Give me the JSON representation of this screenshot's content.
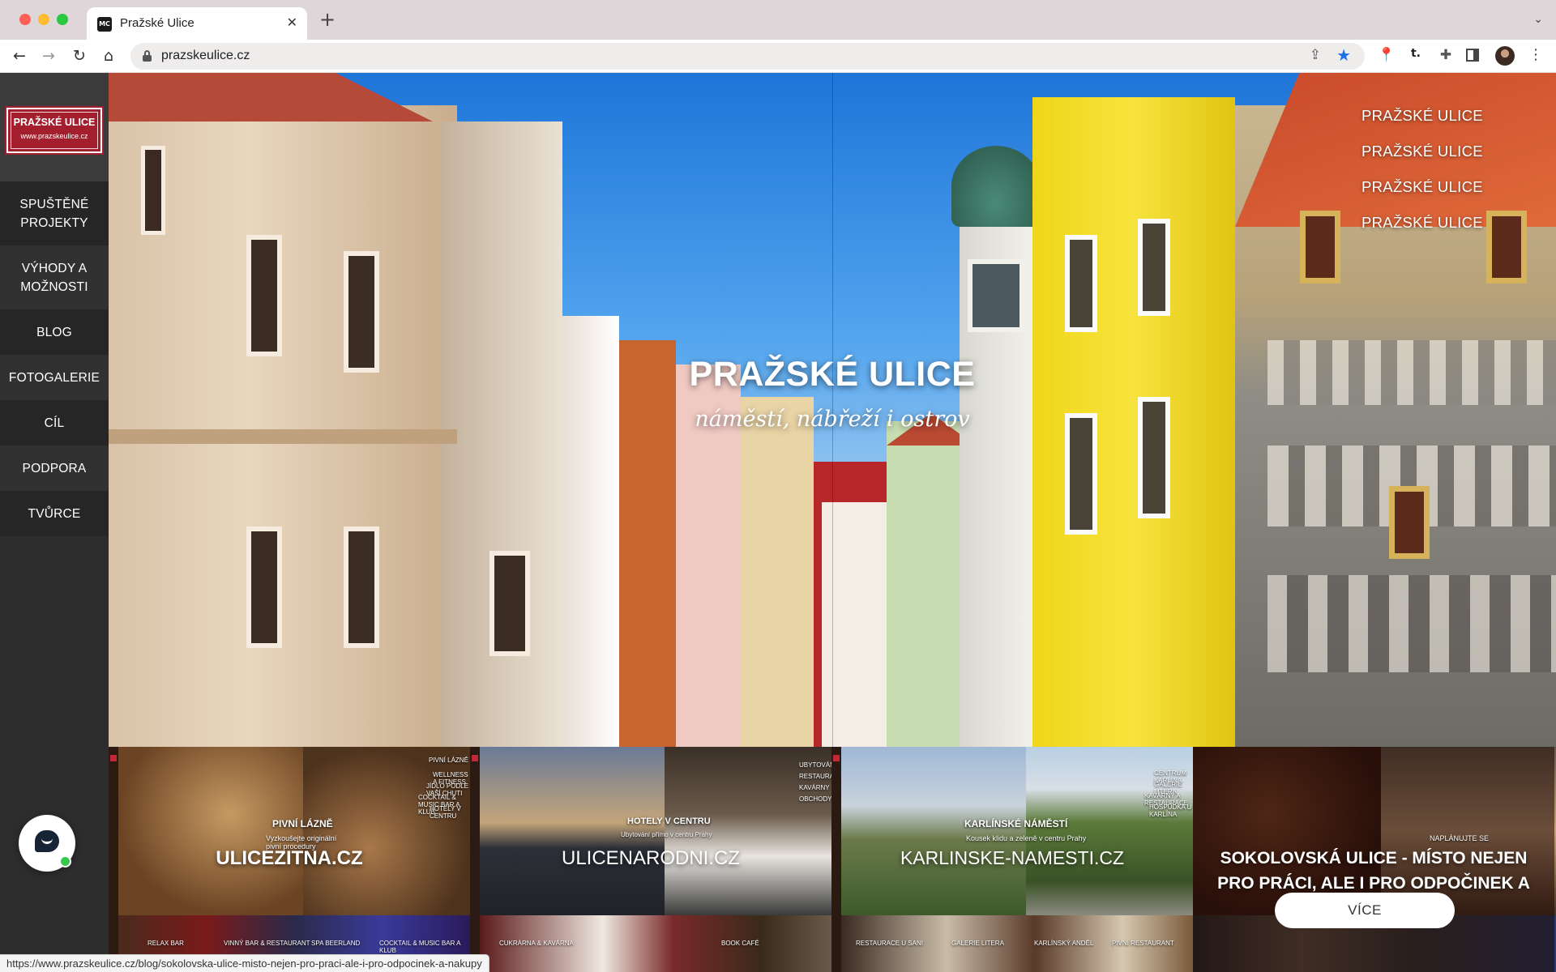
{
  "browser": {
    "tab_title": "Pražské Ulice",
    "tab_favicon_text": "MC",
    "url": "prazskeulice.cz",
    "status_url": "https://www.prazskeulice.cz/blog/sokolovska-ulice-misto-nejen-pro-praci-ale-i-pro-odpocinek-a-nakupy"
  },
  "sidebar": {
    "logo_title": "PRAŽSKÉ ULICE",
    "logo_url": "www.prazskeulice.cz",
    "items": [
      {
        "label": "SPUŠTĚNÉ PROJEKTY"
      },
      {
        "label": "VÝHODY A MOŽNOSTI"
      },
      {
        "label": "BLOG"
      },
      {
        "label": "FOTOGALERIE"
      },
      {
        "label": "CÍL"
      },
      {
        "label": "PODPORA"
      },
      {
        "label": "TVŮRCE"
      }
    ]
  },
  "hero": {
    "title": "PRAŽSKÉ ULICE",
    "subtitle": "náměstí, nábřeží i ostrov",
    "nav": [
      {
        "label": "PRAŽSKÉ ULICE"
      },
      {
        "label": "PRAŽSKÉ ULICE"
      },
      {
        "label": "PRAŽSKÉ ULICE"
      },
      {
        "label": "PRAŽSKÉ ULICE"
      }
    ]
  },
  "tiles": [
    {
      "caption": "ULICEZITNA.CZ",
      "inner_title": "PIVNÍ LÁZNĚ",
      "inner_text": "Vyzkoušejte originální pivní procedury",
      "menu": [
        "PIVNÍ LÁZNĚ",
        "WELLNESS A FITNESS",
        "JÍDLO PODLE VAŠÍ CHUTI",
        "COCKTAIL & MUSIC BAR A KLUB",
        "HOTELY V CENTRU"
      ],
      "strip": [
        "RELAX BAR",
        "VINNÝ BAR & RESTAURANT",
        "SPA BEERLAND",
        "COCKTAIL & MUSIC BAR A KLUB"
      ]
    },
    {
      "caption": "ULICENARODNI.CZ",
      "inner_title": "HOTELY V CENTRU",
      "inner_text": "Ubytování přímo v centru Prahy",
      "menu": [
        "UBYTOVÁNÍ",
        "RESTAURACE",
        "KAVÁRNY",
        "OBCHODY"
      ],
      "strip": [
        "CUKRÁRNA & KAVÁRNA",
        "BOOK CAFÉ"
      ]
    },
    {
      "caption": "KARLINSKE-NAMESTI.CZ",
      "inner_title": "KARLÍNSKÉ NÁMĚSTÍ",
      "inner_text": "Kousek klidu a zeleně v centru Prahy",
      "menu": [
        "CENTRUM KARLÍNA",
        "GALERIE LITERA",
        "KAVÁRNY A RESTAURACE",
        "HOSPŮDKA U KARLÍNA"
      ],
      "strip": [
        "RESTAURACE U SANI",
        "GALERIE LITERA",
        "KARLÍNSKÝ ANDĚL",
        "PIVNÍ RESTAURANT"
      ]
    },
    {
      "caption": "SOKOLOVSKÁ ULICE - MÍSTO NEJEN PRO PRÁCI, ALE I PRO ODPOČINEK A NÁKUPY",
      "inner_title": "NAPLÁNUJTE SE",
      "button_label": "VÍCE"
    }
  ],
  "icons": {
    "back": "arrow-left-icon",
    "forward": "arrow-right-icon",
    "reload": "reload-icon",
    "home": "home-icon",
    "lock": "lock-icon",
    "share": "share-icon",
    "star": "star-icon",
    "chat": "chat-icon"
  },
  "colors": {
    "brand_red": "#a31f2e",
    "sidebar_bg": "#2d2d2d",
    "bookmark_blue": "#1a73e8",
    "chat_online": "#35c94a"
  }
}
